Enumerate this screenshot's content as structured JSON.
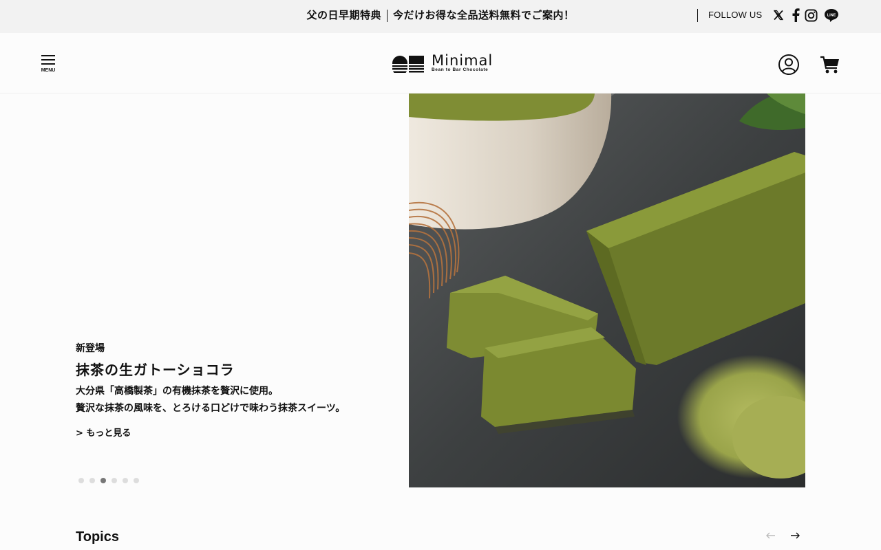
{
  "announcement": {
    "part1": "父の日早期特典",
    "part2": "今だけお得な全品送料無料でご案内！"
  },
  "follow": {
    "label": "FOLLOW US",
    "icons": [
      "x-icon",
      "facebook-icon",
      "instagram-icon",
      "line-icon"
    ]
  },
  "header": {
    "menu_label": "MENU",
    "logo_word": "Minimal",
    "logo_tagline": "Bean to Bar Chocolate"
  },
  "hero": {
    "eyebrow": "新登場",
    "title": "抹茶の生ガトーショコラ",
    "desc_line1": "大分県「高橋製茶」の有機抹茶を贅沢に使用。",
    "desc_line2": "贅沢な抹茶の風味を、とろける口どけで味わう抹茶スイーツ。",
    "more_link": "> もっと見る",
    "slide_count": 6,
    "active_slide": 3
  },
  "topics": {
    "title": "Topics"
  },
  "colors": {
    "text": "#111111",
    "topbar_bg": "#f2f2f2",
    "page_bg": "#fcfcfc",
    "matcha": "#8a9a3a",
    "slate": "#3b3e3f"
  }
}
